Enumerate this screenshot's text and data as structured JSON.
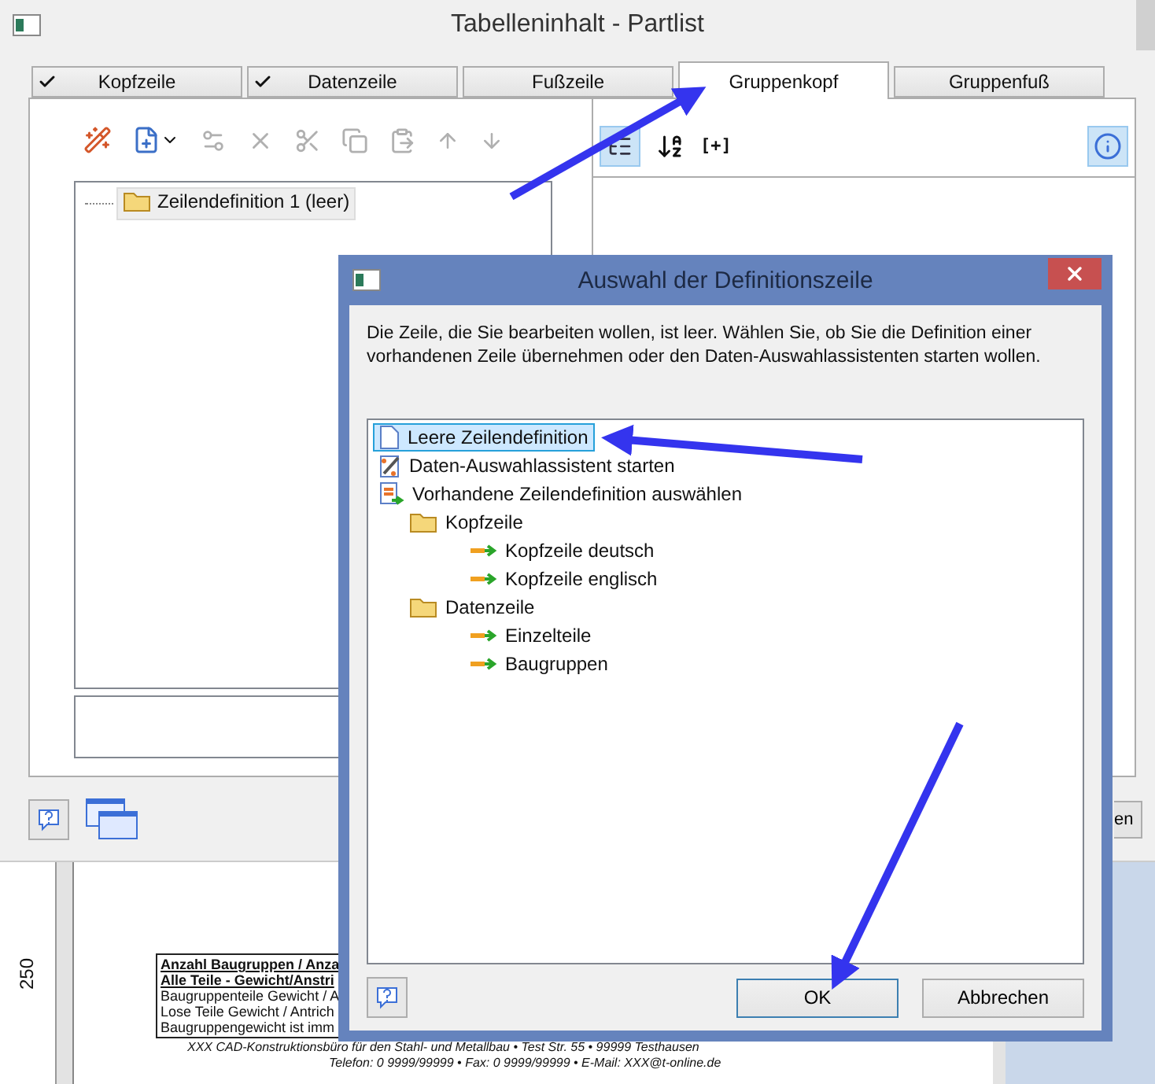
{
  "window": {
    "title": "Tabelleninhalt - Partlist"
  },
  "tabs": [
    {
      "label": "Kopfzeile",
      "checked": true,
      "selected": false
    },
    {
      "label": "Datenzeile",
      "checked": true,
      "selected": false
    },
    {
      "label": "Fußzeile",
      "checked": false,
      "selected": false
    },
    {
      "label": "Gruppenkopf",
      "checked": false,
      "selected": true
    },
    {
      "label": "Gruppenfuß",
      "checked": false,
      "selected": false
    }
  ],
  "row_tree": [
    {
      "label": "Zeilendefinition  1 (leer)",
      "selected": true
    }
  ],
  "right_toolbar": {
    "expand_label": "[+]",
    "tree_view_on": true,
    "info_on": true
  },
  "covered_button_fragment": "en",
  "preview": {
    "ruler_label": "250",
    "lines": [
      {
        "text": "Anzahl Baugruppen / Anza",
        "kind": "heading"
      },
      {
        "text": "Alle Teile - Gewicht/Anstri",
        "kind": "heading"
      },
      {
        "text": "Baugruppenteile Gewicht / A",
        "kind": "body"
      },
      {
        "text": "Lose Teile Gewicht / Antrich",
        "kind": "body"
      },
      {
        "text": "Baugruppengewicht ist imm",
        "kind": "body"
      }
    ],
    "footer_lines": [
      "XXX CAD-Konstruktionsbüro für den Stahl- und Metallbau • Test Str. 55 • 99999 Testhausen",
      "Telefon: 0 9999/99999 • Fax: 0 9999/99999 • E-Mail: XXX@t-online.de"
    ]
  },
  "dialog": {
    "title": "Auswahl der Definitionszeile",
    "message": "Die Zeile, die Sie bearbeiten wollen, ist leer. Wählen Sie, ob Sie die Definition einer vorhandenen Zeile übernehmen oder den Daten-Auswahlassistenten starten wollen.",
    "tree": [
      {
        "label": "Leere Zeilendefinition",
        "kind": "page",
        "selected": true
      },
      {
        "label": "Daten-Auswahlassistent starten",
        "kind": "wizard",
        "selected": false
      },
      {
        "label": "Vorhandene Zeilendefinition auswählen",
        "kind": "rows",
        "selected": false,
        "children": [
          {
            "label": "Kopfzeile",
            "kind": "folder",
            "selected": false,
            "children": [
              {
                "label": "Kopfzeile deutsch",
                "kind": "link",
                "selected": false
              },
              {
                "label": "Kopfzeile englisch",
                "kind": "link",
                "selected": false
              }
            ]
          },
          {
            "label": "Datenzeile",
            "kind": "folder",
            "selected": false,
            "children": [
              {
                "label": "Einzelteile",
                "kind": "link",
                "selected": false
              },
              {
                "label": "Baugruppen",
                "kind": "link",
                "selected": false
              }
            ]
          }
        ]
      }
    ],
    "buttons": [
      {
        "label": "OK",
        "default": true
      },
      {
        "label": "Abbrechen",
        "default": false
      }
    ]
  }
}
